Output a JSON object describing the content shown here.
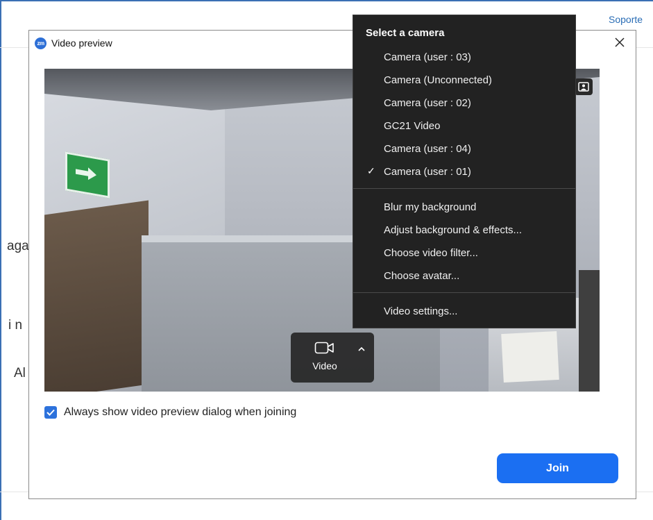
{
  "background": {
    "link_support": "Soporte",
    "fragment_1": "aga",
    "fragment_2": "i n",
    "fragment_3": "Al"
  },
  "dialog": {
    "app_logo": "zm",
    "title": "Video preview",
    "close_icon": "close-icon"
  },
  "video_control": {
    "label": "Video",
    "icon": "video-camera-icon",
    "caret_icon": "chevron-up-icon"
  },
  "checkbox": {
    "label": "Always show video preview dialog when joining",
    "checked": true
  },
  "join_button": {
    "label": "Join"
  },
  "camera_menu": {
    "header": "Select a camera",
    "cameras": [
      {
        "label": "Camera (user : 03)",
        "selected": false
      },
      {
        "label": "Camera (Unconnected)",
        "selected": false
      },
      {
        "label": "Camera (user : 02)",
        "selected": false
      },
      {
        "label": "GC21 Video",
        "selected": false
      },
      {
        "label": "Camera (user : 04)",
        "selected": false
      },
      {
        "label": "Camera (user : 01)",
        "selected": true
      }
    ],
    "effects": [
      {
        "label": "Blur my background"
      },
      {
        "label": "Adjust background & effects..."
      },
      {
        "label": "Choose video filter..."
      },
      {
        "label": "Choose avatar..."
      }
    ],
    "settings": {
      "label": "Video settings..."
    },
    "check_mark": "✓"
  },
  "colors": {
    "accent": "#1b6ff2",
    "menu_bg": "#222222"
  }
}
